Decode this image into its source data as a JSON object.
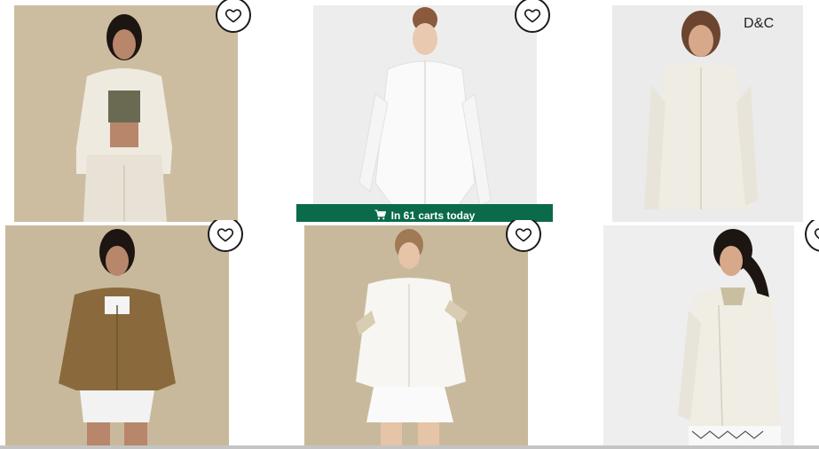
{
  "products": [
    {
      "name": "product-card-1",
      "has_favorite": true,
      "badge": ""
    },
    {
      "name": "product-card-2",
      "has_favorite": true,
      "badge": ""
    },
    {
      "name": "product-card-3",
      "has_favorite": false,
      "badge": "D&C"
    },
    {
      "name": "product-card-4",
      "has_favorite": true,
      "badge": ""
    },
    {
      "name": "product-card-5",
      "has_favorite": true,
      "badge": ""
    },
    {
      "name": "product-card-6",
      "has_favorite": true,
      "badge": ""
    }
  ],
  "banner": {
    "text": "In 61 carts today"
  },
  "icons": {
    "favorite": "heart-outline-icon",
    "cart": "shopping-cart-icon"
  },
  "colors": {
    "banner_bg": "#0b6a4a",
    "banner_text": "#ffffff",
    "photo_tan": "#c8b89b",
    "photo_grey": "#ececec",
    "photo_light": "#f2f2f2"
  }
}
